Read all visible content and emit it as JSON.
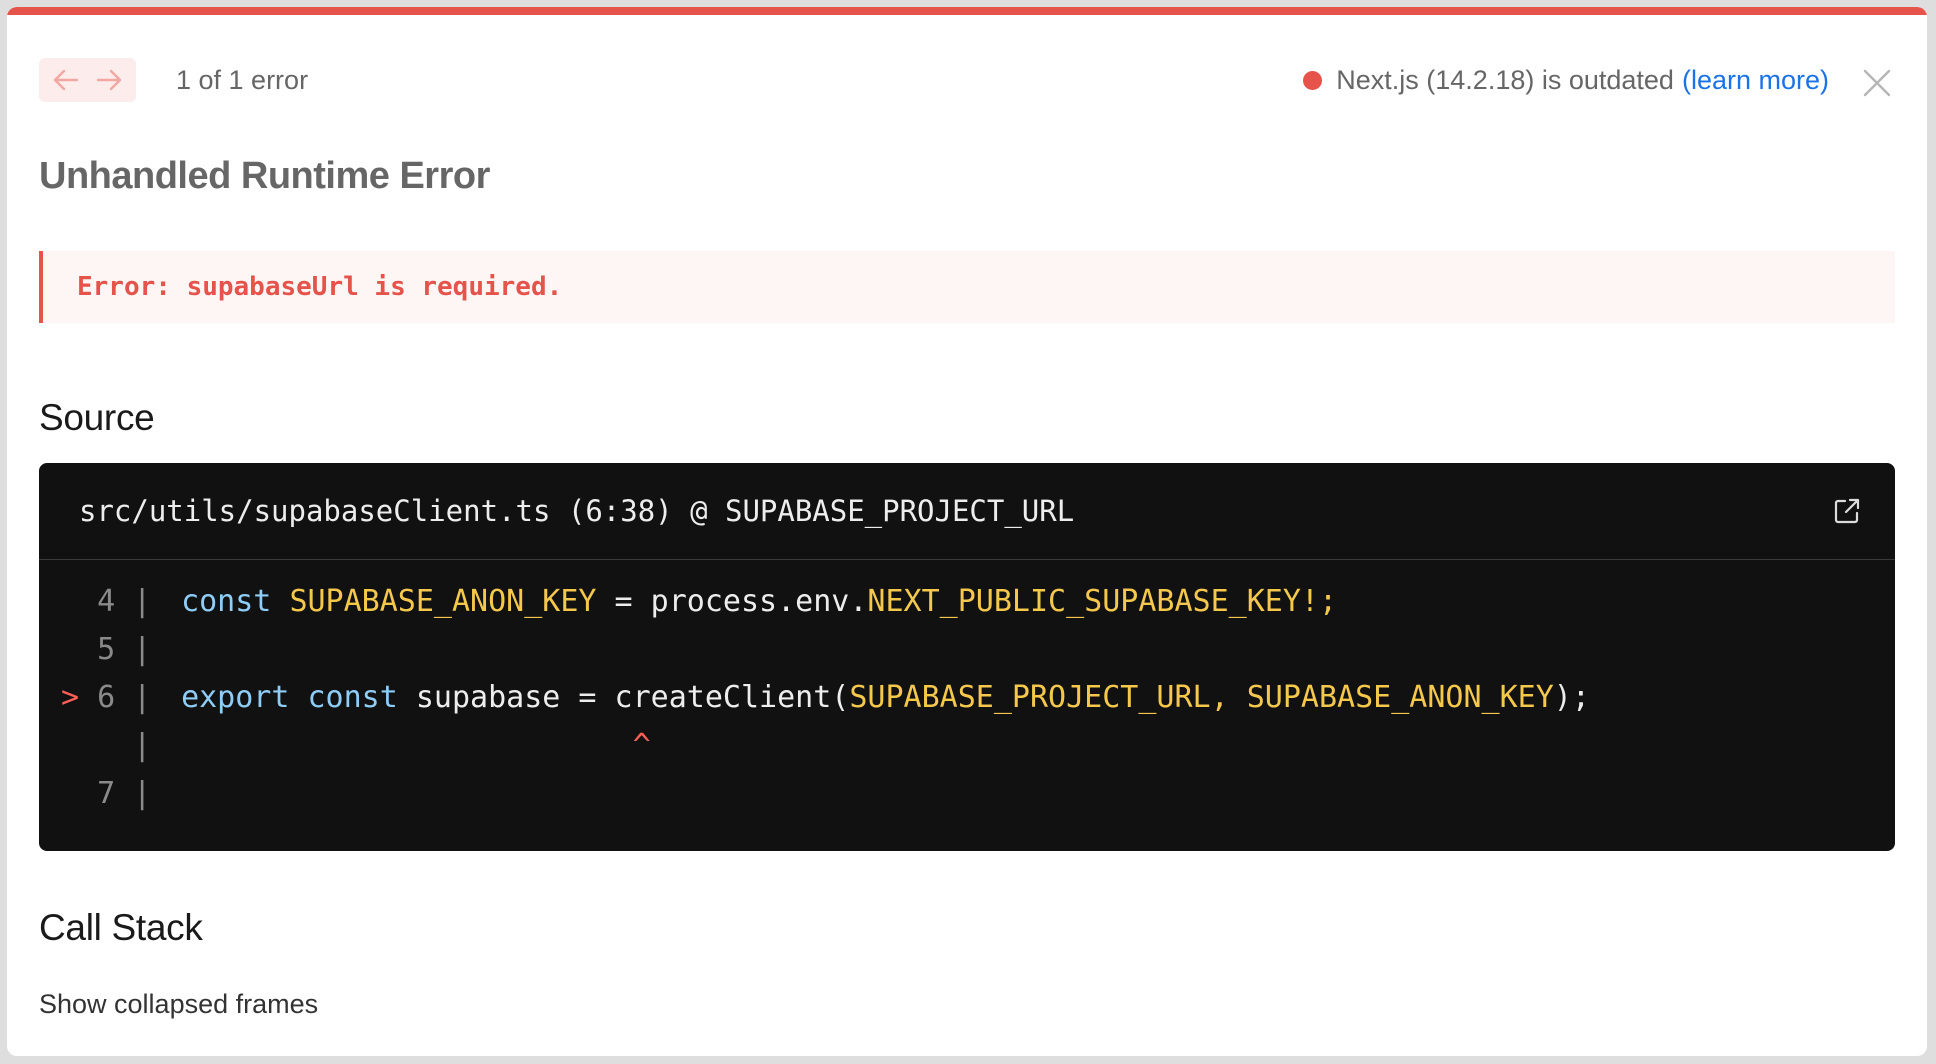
{
  "header": {
    "prev_label": "←",
    "next_label": "→",
    "error_count": "1 of 1 error",
    "version_text": "Next.js (14.2.18) is outdated",
    "learn_more": "(learn more)",
    "close_label": "×"
  },
  "title": "Unhandled Runtime Error",
  "error_message": "Error: supabaseUrl is required.",
  "source": {
    "heading": "Source",
    "file_location": "src/utils/supabaseClient.ts (6:38) @ SUPABASE_PROJECT_URL",
    "lines": [
      {
        "marker": "",
        "gutter": "4 | ",
        "tokens": [
          {
            "t": "const",
            "k": "kw"
          },
          {
            "t": " ",
            "k": "plain"
          },
          {
            "t": "SUPABASE_ANON_KEY",
            "k": "const"
          },
          {
            "t": " = process.env.",
            "k": "plain"
          },
          {
            "t": "NEXT_PUBLIC_SUPABASE_KEY!;",
            "k": "const"
          }
        ]
      },
      {
        "marker": "",
        "gutter": "5 | ",
        "tokens": []
      },
      {
        "marker": ">",
        "gutter": "6 | ",
        "tokens": [
          {
            "t": "export",
            "k": "kw"
          },
          {
            "t": " ",
            "k": "plain"
          },
          {
            "t": "const",
            "k": "kw"
          },
          {
            "t": " supabase = createClient(",
            "k": "plain"
          },
          {
            "t": "SUPABASE_PROJECT_URL, SUPABASE_ANON_KEY",
            "k": "const"
          },
          {
            "t": ");",
            "k": "plain"
          }
        ]
      },
      {
        "marker": "",
        "gutter": "  | ",
        "tokens": [
          {
            "t": "                         ^",
            "k": "caret"
          }
        ]
      },
      {
        "marker": "",
        "gutter": "7 | ",
        "tokens": []
      }
    ]
  },
  "call_stack": {
    "heading": "Call Stack",
    "toggle": "Show collapsed frames"
  },
  "colors": {
    "accent": "#e5534b",
    "link": "#1a73e8",
    "keyword": "#8ecdf7",
    "constant": "#f5c84c"
  },
  "icons": {
    "prev": "arrow-left-icon",
    "next": "arrow-right-icon",
    "close": "close-icon",
    "open_editor": "external-link-icon"
  }
}
